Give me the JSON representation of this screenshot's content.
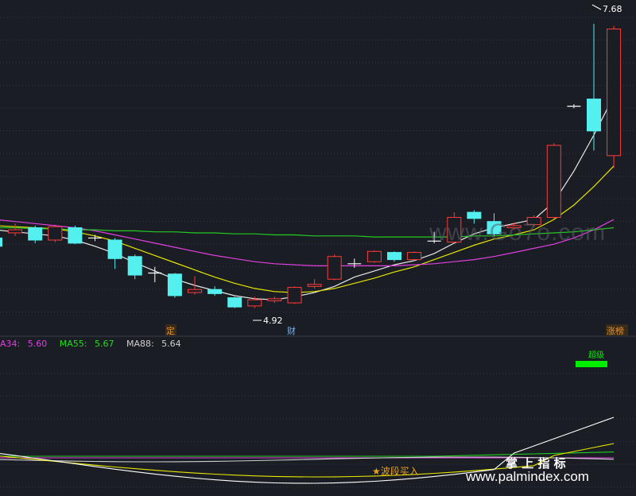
{
  "chart_data": {
    "type": "candlestick",
    "price_range": [
      4.7,
      7.85
    ],
    "high_label": "7.68",
    "low_label": "4.92",
    "markers": [
      "定",
      "财",
      "涨榜"
    ],
    "legend": [
      {
        "label": "A34:",
        "value": "5.60",
        "color": "#e040e0"
      },
      {
        "label": "MA55:",
        "value": "5.67",
        "color": "#22dd22"
      },
      {
        "label": "MA88:",
        "value": "5.64",
        "color": "#cfcfcf"
      }
    ],
    "candles": [
      {
        "o": 5.6,
        "c": 5.52,
        "h": 5.72,
        "l": 5.5
      },
      {
        "o": 5.65,
        "c": 5.68,
        "h": 5.74,
        "l": 5.62
      },
      {
        "o": 5.7,
        "c": 5.58,
        "h": 5.72,
        "l": 5.55
      },
      {
        "o": 5.58,
        "c": 5.71,
        "h": 5.73,
        "l": 5.56
      },
      {
        "o": 5.7,
        "c": 5.55,
        "h": 5.72,
        "l": 5.54
      },
      {
        "o": 5.6,
        "c": 5.6,
        "h": 5.63,
        "l": 5.57
      },
      {
        "o": 5.58,
        "c": 5.4,
        "h": 5.6,
        "l": 5.3
      },
      {
        "o": 5.42,
        "c": 5.24,
        "h": 5.44,
        "l": 5.2
      },
      {
        "o": 5.26,
        "c": 5.26,
        "h": 5.32,
        "l": 5.17
      },
      {
        "o": 5.25,
        "c": 5.04,
        "h": 5.26,
        "l": 5.02
      },
      {
        "o": 5.07,
        "c": 5.1,
        "h": 5.23,
        "l": 5.05
      },
      {
        "o": 5.1,
        "c": 5.06,
        "h": 5.13,
        "l": 5.04
      },
      {
        "o": 5.02,
        "c": 4.93,
        "h": 5.03,
        "l": 4.92
      },
      {
        "o": 4.94,
        "c": 5.0,
        "h": 5.03,
        "l": 4.92
      },
      {
        "o": 4.99,
        "c": 5.01,
        "h": 5.03,
        "l": 4.97
      },
      {
        "o": 4.97,
        "c": 5.12,
        "h": 5.13,
        "l": 4.96
      },
      {
        "o": 5.13,
        "c": 5.15,
        "h": 5.2,
        "l": 5.11
      },
      {
        "o": 5.2,
        "c": 5.42,
        "h": 5.44,
        "l": 5.19
      },
      {
        "o": 5.35,
        "c": 5.35,
        "h": 5.4,
        "l": 5.31
      },
      {
        "o": 5.37,
        "c": 5.47,
        "h": 5.48,
        "l": 5.36
      },
      {
        "o": 5.46,
        "c": 5.39,
        "h": 5.47,
        "l": 5.37
      },
      {
        "o": 5.39,
        "c": 5.46,
        "h": 5.47,
        "l": 5.38
      },
      {
        "o": 5.57,
        "c": 5.57,
        "h": 5.66,
        "l": 5.55
      },
      {
        "o": 5.56,
        "c": 5.8,
        "h": 5.85,
        "l": 5.55
      },
      {
        "o": 5.85,
        "c": 5.79,
        "h": 5.87,
        "l": 5.74
      },
      {
        "o": 5.76,
        "c": 5.64,
        "h": 5.84,
        "l": 5.62
      },
      {
        "o": 5.7,
        "c": 5.72,
        "h": 5.75,
        "l": 5.68
      },
      {
        "o": 5.73,
        "c": 5.8,
        "h": 5.82,
        "l": 5.71
      },
      {
        "o": 5.8,
        "c": 6.5,
        "h": 6.52,
        "l": 5.79
      },
      {
        "o": 6.88,
        "c": 6.88,
        "h": 6.9,
        "l": 6.86
      },
      {
        "o": 6.95,
        "c": 6.64,
        "h": 7.68,
        "l": 6.45
      },
      {
        "o": 6.4,
        "c": 7.63,
        "h": 7.66,
        "l": 6.28
      }
    ],
    "ma": [
      {
        "name": "white",
        "color": "#e8e8e8",
        "values": [
          5.68,
          5.66,
          5.64,
          5.62,
          5.58,
          5.52,
          5.45,
          5.36,
          5.28,
          5.2,
          5.14,
          5.09,
          5.04,
          5.01,
          5.0,
          5.03,
          5.07,
          5.13,
          5.22,
          5.28,
          5.34,
          5.38,
          5.45,
          5.55,
          5.64,
          5.7,
          5.74,
          5.78,
          5.95,
          6.25,
          6.6,
          6.98
        ]
      },
      {
        "name": "yellow",
        "color": "#e6e600",
        "values": [
          5.72,
          5.71,
          5.7,
          5.69,
          5.66,
          5.62,
          5.57,
          5.5,
          5.43,
          5.36,
          5.29,
          5.22,
          5.16,
          5.11,
          5.08,
          5.07,
          5.08,
          5.11,
          5.16,
          5.21,
          5.27,
          5.32,
          5.39,
          5.46,
          5.53,
          5.59,
          5.63,
          5.68,
          5.78,
          5.92,
          6.1,
          6.3
        ]
      },
      {
        "name": "magenta",
        "color": "#e040e0",
        "values": [
          5.78,
          5.76,
          5.74,
          5.72,
          5.7,
          5.67,
          5.63,
          5.59,
          5.55,
          5.51,
          5.47,
          5.43,
          5.4,
          5.37,
          5.35,
          5.34,
          5.33,
          5.33,
          5.33,
          5.33,
          5.33,
          5.34,
          5.35,
          5.37,
          5.39,
          5.42,
          5.46,
          5.5,
          5.54,
          5.6,
          5.68,
          5.78
        ]
      },
      {
        "name": "green",
        "color": "#22cc22",
        "values": [
          5.7,
          5.7,
          5.69,
          5.69,
          5.68,
          5.68,
          5.67,
          5.67,
          5.66,
          5.66,
          5.65,
          5.65,
          5.64,
          5.64,
          5.63,
          5.63,
          5.62,
          5.62,
          5.62,
          5.61,
          5.61,
          5.61,
          5.61,
          5.61,
          5.62,
          5.62,
          5.63,
          5.64,
          5.65,
          5.66,
          5.68,
          5.7
        ]
      }
    ]
  },
  "indicator": {
    "label_green": "超级",
    "label_buy": "★波段买入"
  },
  "watermark": {
    "site": "www.Go7o.com",
    "brand_cn": "掌 上 指 标",
    "brand_url": "www.palmindex.com"
  }
}
